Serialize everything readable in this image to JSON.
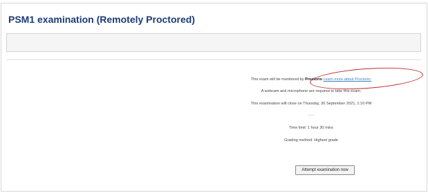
{
  "page": {
    "title": "PSM1 examination (Remotely Proctored)"
  },
  "info": {
    "monitor_prefix": "This exam will be monitored by",
    "monitor_brand": "Proctorio",
    "monitor_link": "Learn more about Proctorio.",
    "webcam_note": "A webcam and microphone are required to take this exam.",
    "close_note": "This examination will close on Thursday, 30 September 2021, 1:10 PM",
    "separator": "-----",
    "time_limit": "Time limit: 1 hour 30 mins",
    "grading_method": "Grading method: Highest grade"
  },
  "actions": {
    "attempt_label": "Attempt examination now"
  },
  "colors": {
    "title": "#1b3a78",
    "link": "#3a7fc4",
    "annotation_circle": "#c2272d"
  }
}
